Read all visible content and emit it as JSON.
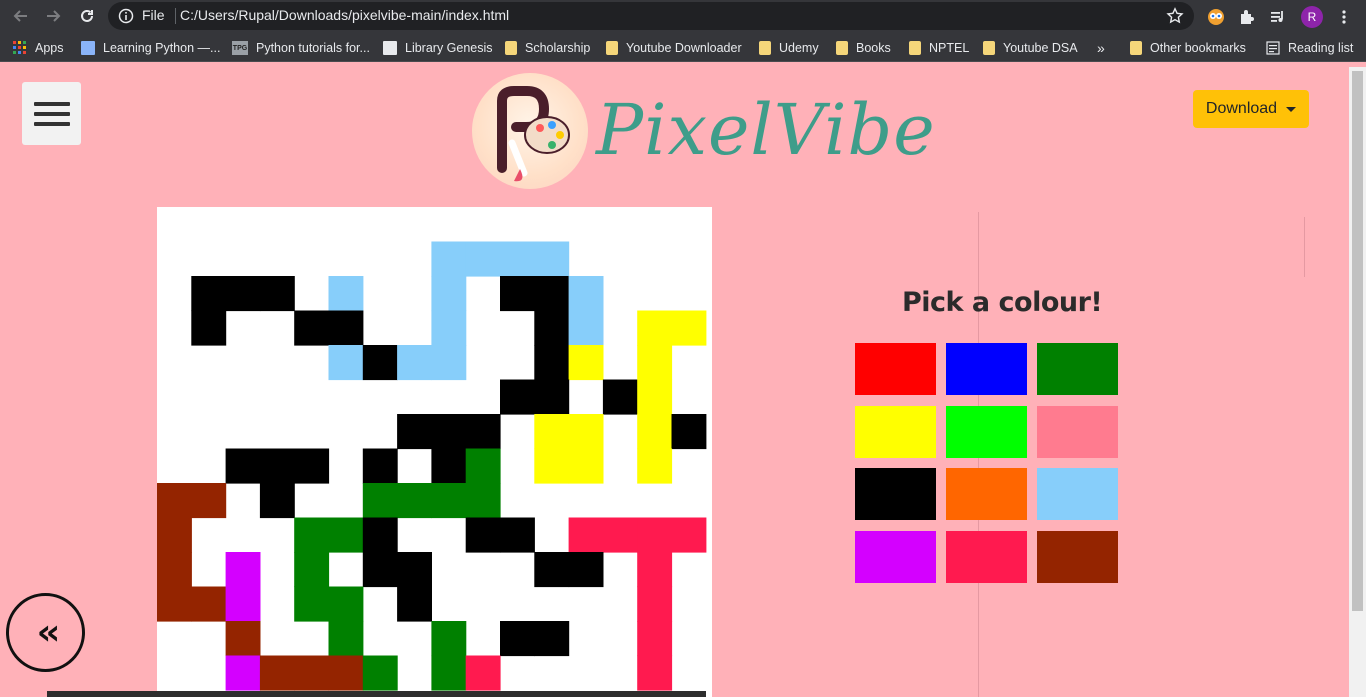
{
  "browser": {
    "scheme_label": "File",
    "url": "C:/Users/Rupal/Downloads/pixelvibe-main/index.html",
    "avatar_initial": "R",
    "bookmarks": [
      {
        "label": "Apps",
        "icon": "apps-grid-icon"
      },
      {
        "label": "Learning Python —...",
        "icon": "book-icon"
      },
      {
        "label": "Python tutorials for...",
        "icon": "tpg-icon"
      },
      {
        "label": "Library Genesis",
        "icon": "library-icon"
      },
      {
        "label": "Scholarship",
        "icon": "folder-icon"
      },
      {
        "label": "Youtube Downloader",
        "icon": "folder-icon"
      },
      {
        "label": "Udemy",
        "icon": "folder-icon"
      },
      {
        "label": "Books",
        "icon": "folder-icon"
      },
      {
        "label": "NPTEL",
        "icon": "folder-icon"
      },
      {
        "label": "Youtube DSA",
        "icon": "folder-icon"
      }
    ],
    "overflow_label": "»",
    "other_bookmarks": "Other bookmarks",
    "reading_list": "Reading list"
  },
  "header": {
    "logo_text": "PixelVibe",
    "download_label": "Download"
  },
  "palette": {
    "title": "Pick a colour!",
    "colors": [
      "#ff0000",
      "#0000ff",
      "#008000",
      "#ffff00",
      "#00ff00",
      "#ff7b8f",
      "#000000",
      "#ff6600",
      "#87cefa",
      "#d400ff",
      "#ff1a4f",
      "#942400"
    ]
  },
  "back_label": "‹‹",
  "grid": {
    "cols": 16,
    "rows": 14,
    "colors": {
      "w": "#ffffff",
      "k": "#000000",
      "b": "#87cefa",
      "y": "#ffff00",
      "g": "#008000",
      "r": "#942400",
      "m": "#d400ff",
      "p": "#ff1a4f"
    },
    "cells": [
      "wwwwwwwwwwwwwwww",
      "wwwwwwwwbbbbwwww",
      "wkkkwbwwbwkkbwww",
      "wkwwkkwwbwwkbwyy",
      "wwwwwbkbbwwkywyw",
      "wwwwwwwwwwkkwkyw",
      "wwwwwwwkkkwyywyk",
      "wwkkkwkwkgwyywyw",
      "rrwkwwggggwwwwww",
      "rwwwggkwwkkwppppw",
      "rwmwgwkkwwwkkwpw",
      "rrmwggwkwwwwwwpw",
      "wwrwwgwwgwkkwwpw",
      "wwmrrrgwgpwwwwpw"
    ]
  }
}
